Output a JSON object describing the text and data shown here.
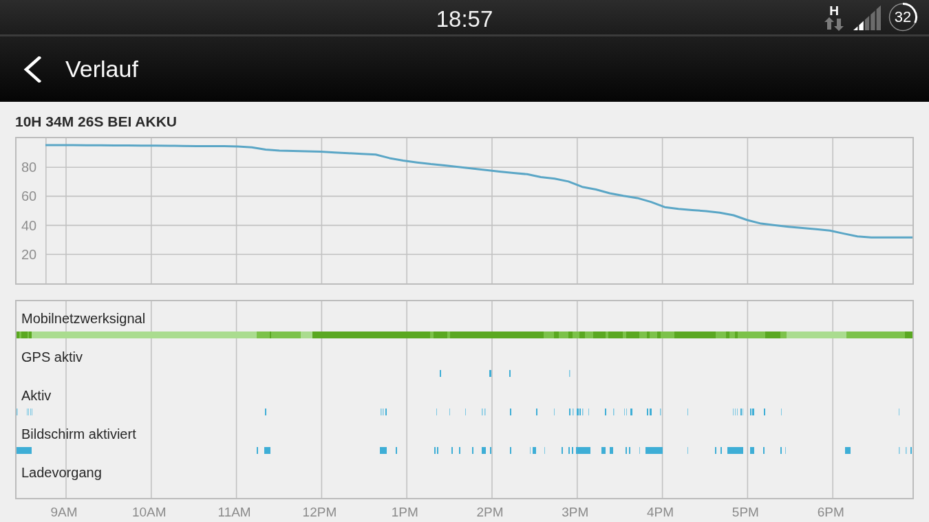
{
  "status_bar": {
    "time": "18:57",
    "network_type": "H",
    "battery_text": "32"
  },
  "header": {
    "title": "Verlauf"
  },
  "history": {
    "title": "10H 34M 26S BEI AKKU",
    "chart_data": {
      "type": "line",
      "categories": [
        null,
        null,
        null,
        null,
        null,
        null,
        null,
        null,
        null,
        null,
        null,
        null,
        null,
        null,
        null,
        null,
        null,
        null,
        null,
        null,
        null,
        null,
        null,
        null,
        null,
        null,
        null,
        null,
        null,
        null,
        null,
        null,
        null,
        null,
        null,
        null,
        null,
        null,
        null,
        null,
        null,
        null,
        null,
        null,
        null,
        null,
        null,
        null,
        null,
        null,
        null,
        null,
        null,
        null,
        null,
        null,
        null,
        null,
        null,
        null,
        null,
        null,
        null,
        null
      ],
      "series": [
        {
          "color": "#5aa6c6",
          "values": [
            95.3,
            95.2,
            95.2,
            95.1,
            95.1,
            95.0,
            95.0,
            94.9,
            94.9,
            94.8,
            94.7,
            94.6,
            94.6,
            94.5,
            94.3,
            93.7,
            92.2,
            91.4,
            91.2,
            91.0,
            90.7,
            90.2,
            89.7,
            89.2,
            88.7,
            86.3,
            84.6,
            83.3,
            82.2,
            81.3,
            80.2,
            79.1,
            78.1,
            77.0,
            76.0,
            75.2,
            73.2,
            72.2,
            70.2,
            66.5,
            64.7,
            62.1,
            60.3,
            58.8,
            56.1,
            52.5,
            51.3,
            50.5,
            49.8,
            48.7,
            46.9,
            43.6,
            41.2,
            40.0,
            39.0,
            38.1,
            37.3,
            36.4,
            34.3,
            32.3,
            31.6,
            31.6,
            31.6,
            31.6
          ]
        }
      ],
      "ylim": [
        0,
        100
      ],
      "yticks": [
        20,
        40,
        60,
        80
      ],
      "grid": true
    },
    "activity_rows": [
      {
        "label": "Mobilnetzwerksignal",
        "kind": "signal"
      },
      {
        "label": "GPS aktiv",
        "kind": "events"
      },
      {
        "label": "Aktiv",
        "kind": "events"
      },
      {
        "label": "Bildschirm aktiviert",
        "kind": "events"
      },
      {
        "label": "Ladevorgang",
        "kind": "idle"
      }
    ],
    "time_axis": [
      "9AM",
      "10AM",
      "11AM",
      "12PM",
      "1PM",
      "2PM",
      "3PM",
      "4PM",
      "5PM",
      "6PM"
    ]
  }
}
